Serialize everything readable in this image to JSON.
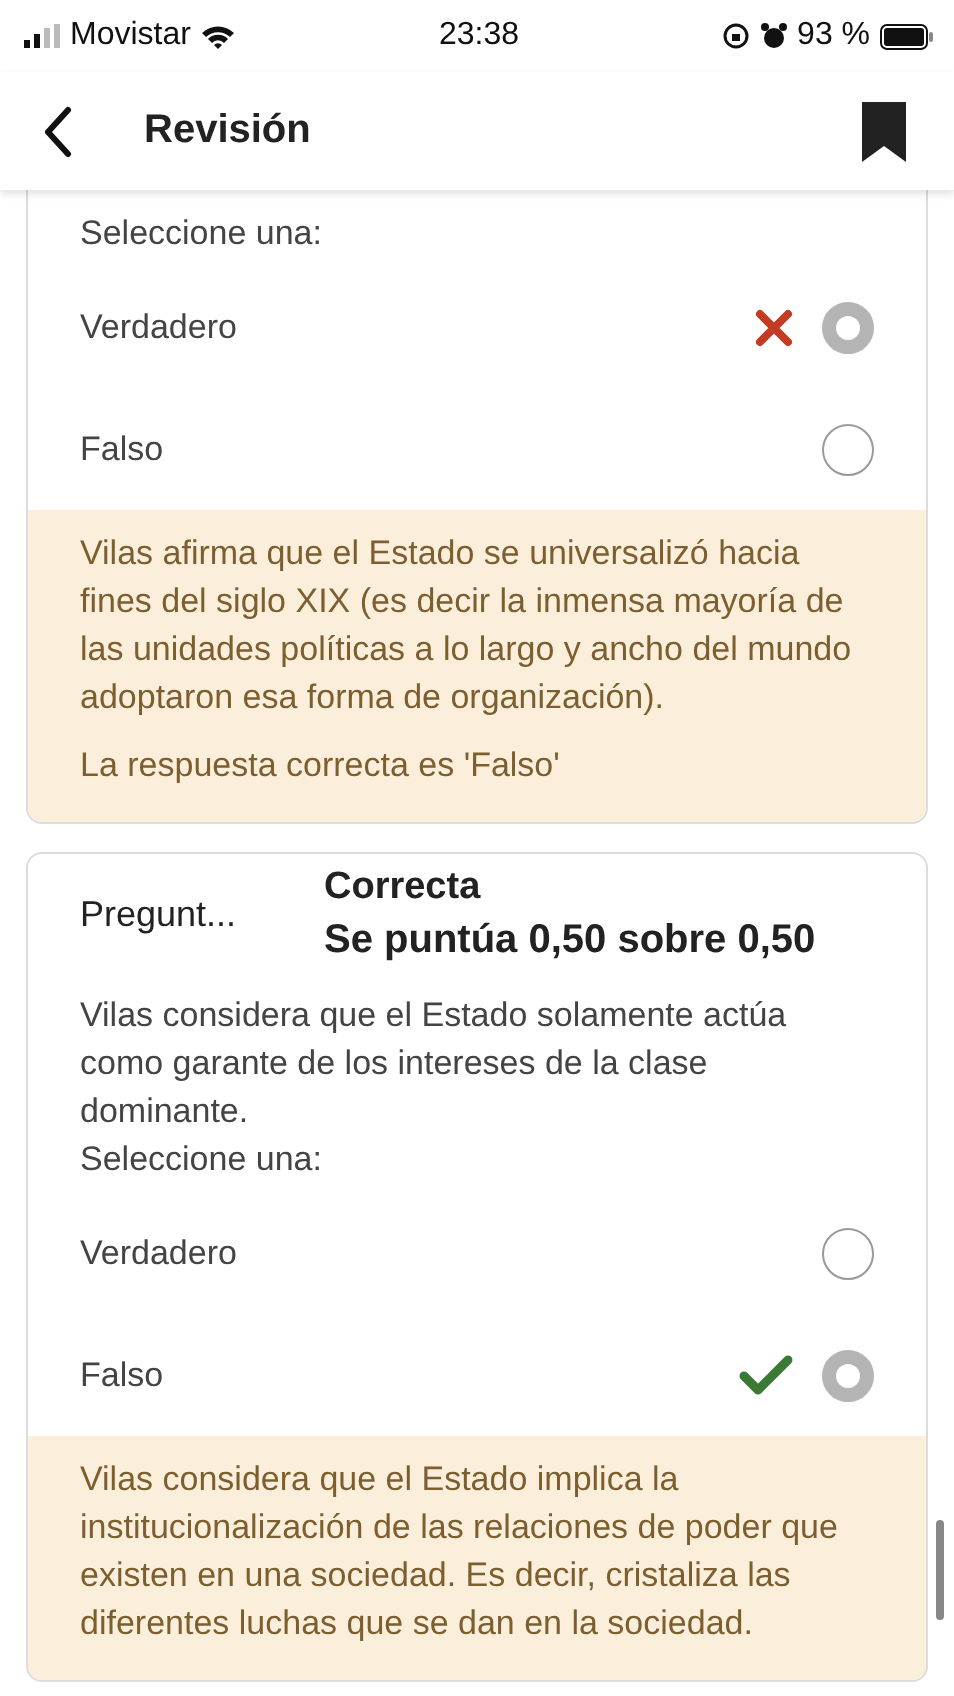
{
  "status_bar": {
    "carrier": "Movistar",
    "time": "23:38",
    "battery": "93 %"
  },
  "header": {
    "title": "Revisión"
  },
  "questions": [
    {
      "prompt_lines": [
        "Seleccione una:"
      ],
      "options": [
        {
          "label": "Verdadero",
          "selected": true,
          "kind": "incorrect"
        },
        {
          "label": "Falso",
          "selected": false,
          "kind": "plain"
        }
      ],
      "feedback": [
        "Vilas afirma que el Estado se universalizó hacia fines del siglo XIX (es decir la inmensa mayoría de las unidades políticas a lo largo y ancho del mundo adoptaron esa forma de organización).",
        "La respuesta correcta es 'Falso'"
      ]
    },
    {
      "label": "Pregunt...",
      "state": "Correcta",
      "grade": "Se puntúa 0,50 sobre 0,50",
      "prompt_lines": [
        "Vilas considera que el Estado solamente actúa como garante de los intereses de la clase dominante.",
        "Seleccione una:"
      ],
      "options": [
        {
          "label": "Verdadero",
          "selected": false,
          "kind": "plain"
        },
        {
          "label": "Falso",
          "selected": true,
          "kind": "correct"
        }
      ],
      "feedback": [
        "Vilas considera que el Estado implica la institucionalización de las relaciones de poder que existen en una sociedad. Es decir, cristaliza las diferentes luchas que se dan en la sociedad."
      ]
    }
  ]
}
